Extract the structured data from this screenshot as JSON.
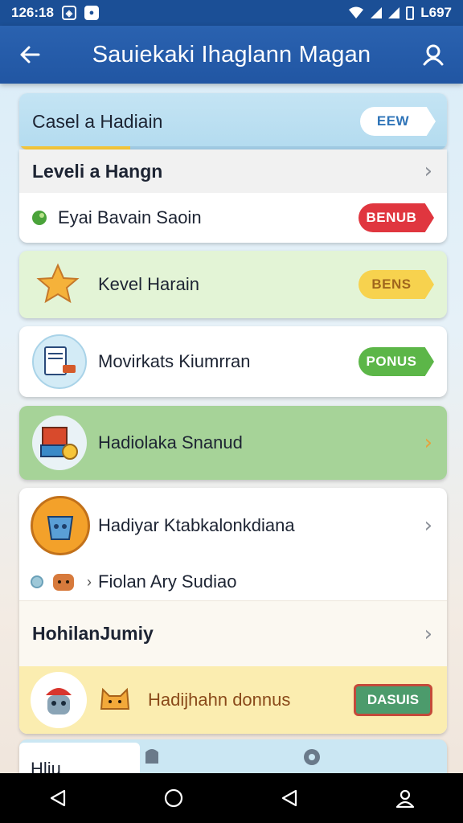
{
  "status_bar": {
    "time": "126:18",
    "right_text": "L697"
  },
  "app_bar": {
    "title": "Sauiekaki Ihaglann Magan"
  },
  "header_card": {
    "title": "Casel a Hadiain",
    "button": "EEW"
  },
  "level_card": {
    "title": "Leveli a Hangn",
    "item_label": "Eyai Bavain Saoin",
    "item_button": "BENUB",
    "item_button_color": "#e0363f"
  },
  "cards": [
    {
      "label": "Kevel Harain",
      "button": "BENS",
      "bg": "#e3f4d6",
      "button_color": "#f7d24e"
    },
    {
      "label": "Movirkats Kiumrran",
      "button": "PONUS",
      "bg": "#ffffff",
      "button_color": "#5cb648"
    },
    {
      "label": "Hadiolaka Snanud",
      "bg": "#a6d398"
    }
  ],
  "detail_card": {
    "title": "Hadiyar Ktabkalonkdiana",
    "sub_label": "Fiolan Ary Sudiao",
    "section_title": "HohilanJumiy",
    "bonus_label": "Hadijhahn donnus",
    "bonus_button": "DASUIS",
    "bonus_button_color": "#4c9b6c"
  },
  "footer_card": {
    "label": "Hliu"
  },
  "icons": {
    "back": "arrow-left-icon",
    "user": "user-icon",
    "star": "star-icon",
    "book": "book-icon",
    "gift": "gift-icon",
    "bucket": "bucket-icon",
    "robot": "robot-icon",
    "cat": "cat-icon",
    "nav_back": "triangle-back-icon",
    "nav_home": "circle-home-icon",
    "nav_recent": "triangle-recent-icon",
    "nav_account": "account-icon"
  }
}
